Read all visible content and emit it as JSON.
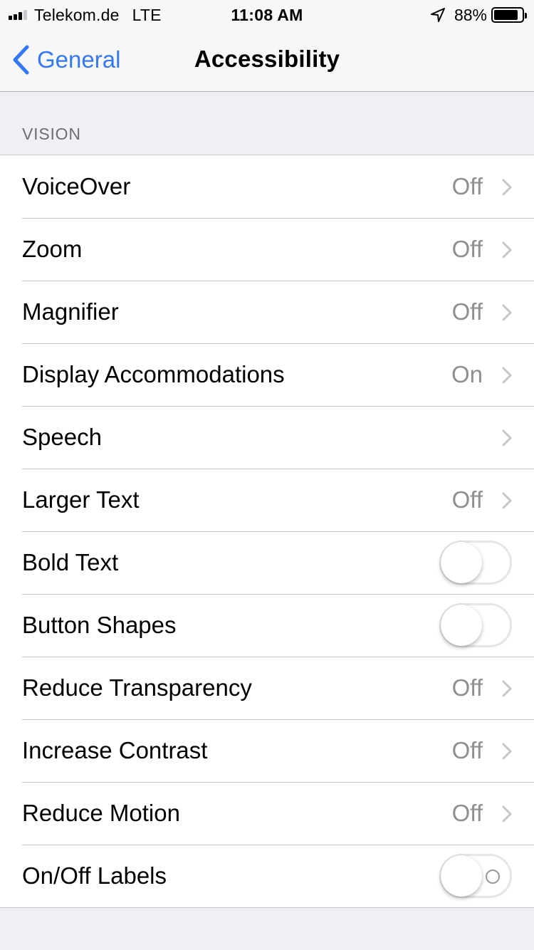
{
  "status_bar": {
    "carrier": "Telekom.de",
    "network": "LTE",
    "time": "11:08 AM",
    "battery_percent": "88%",
    "battery_level": 0.88,
    "icons": [
      "signal-icon",
      "location-icon",
      "battery-icon"
    ]
  },
  "nav": {
    "back_label": "General",
    "title": "Accessibility",
    "accent_color": "#3478f6"
  },
  "section": {
    "header": "VISION"
  },
  "rows": [
    {
      "label": "VoiceOver",
      "value": "Off",
      "kind": "disclosure"
    },
    {
      "label": "Zoom",
      "value": "Off",
      "kind": "disclosure"
    },
    {
      "label": "Magnifier",
      "value": "Off",
      "kind": "disclosure"
    },
    {
      "label": "Display Accommodations",
      "value": "On",
      "kind": "disclosure"
    },
    {
      "label": "Speech",
      "value": "",
      "kind": "disclosure"
    },
    {
      "label": "Larger Text",
      "value": "Off",
      "kind": "disclosure"
    },
    {
      "label": "Bold Text",
      "kind": "toggle",
      "on": false
    },
    {
      "label": "Button Shapes",
      "kind": "toggle",
      "on": false
    },
    {
      "label": "Reduce Transparency",
      "value": "Off",
      "kind": "disclosure"
    },
    {
      "label": "Increase Contrast",
      "value": "Off",
      "kind": "disclosure"
    },
    {
      "label": "Reduce Motion",
      "value": "Off",
      "kind": "disclosure"
    },
    {
      "label": "On/Off Labels",
      "kind": "toggle",
      "on": false,
      "shows_label_mark": true
    }
  ]
}
